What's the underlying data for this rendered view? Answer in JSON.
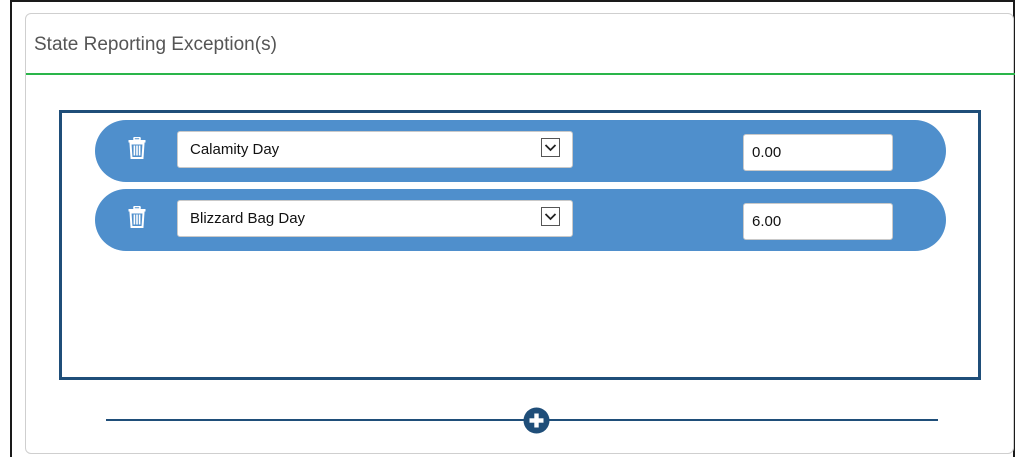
{
  "section": {
    "title": "State Reporting Exception(s)"
  },
  "exceptions": {
    "rows": [
      {
        "type": "Calamity Day",
        "value": "0.00"
      },
      {
        "type": "Blizzard Bag Day",
        "value": "6.00"
      }
    ]
  },
  "icons": {
    "delete": "trash-icon",
    "dropdown": "chevron-down-icon",
    "add": "plus-circle-icon"
  },
  "colors": {
    "title_rule": "#2ab54a",
    "row_background": "#4f8fcc",
    "box_border": "#1f4e79",
    "add_button": "#1f4e79"
  }
}
